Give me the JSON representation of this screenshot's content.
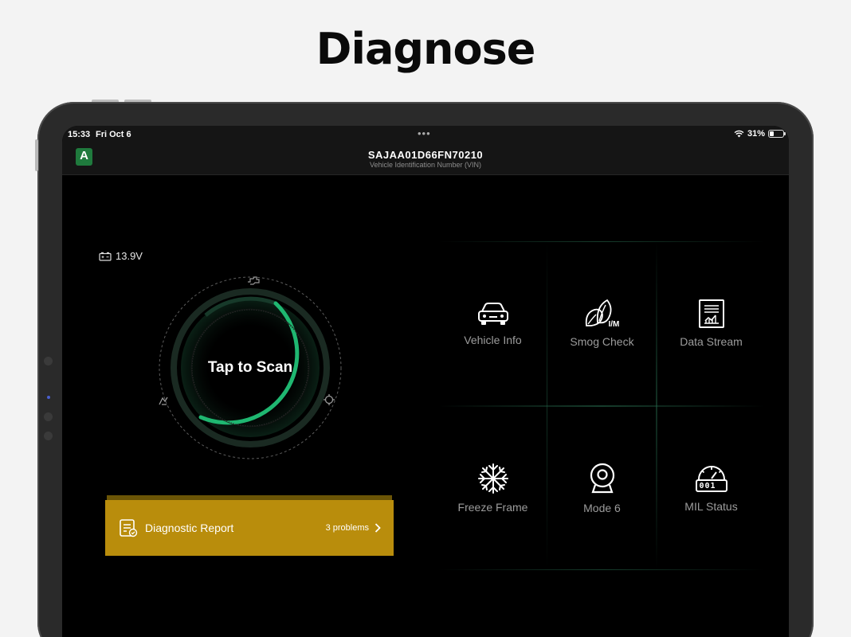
{
  "headline": "Diagnose",
  "status_bar": {
    "time": "15:33",
    "date": "Fri Oct 6",
    "dots": "•••",
    "battery_percent": "31%"
  },
  "nav": {
    "logo_letter": "A",
    "vin": "SAJAA01D66FN70210",
    "vin_caption": "Vehicle Identification Number (VIN)"
  },
  "voltage": "13.9V",
  "scan": {
    "label": "Tap to Scan"
  },
  "report": {
    "title": "Diagnostic Report",
    "count": "3 problems"
  },
  "grid": [
    {
      "label": "Vehicle Info",
      "icon": "car-icon"
    },
    {
      "label": "Smog Check",
      "icon": "leaf-im-icon"
    },
    {
      "label": "Data Stream",
      "icon": "data-stream-icon"
    },
    {
      "label": "Freeze Frame",
      "icon": "snowflake-icon"
    },
    {
      "label": "Mode 6",
      "icon": "webcam-icon"
    },
    {
      "label": "MIL Status",
      "icon": "odometer-icon"
    }
  ],
  "smog_badge": "I/M",
  "odometer_digits": "001",
  "colors": {
    "accent": "#1fb771",
    "report_bg": "#b98d0c",
    "screen_bg": "#000000"
  }
}
